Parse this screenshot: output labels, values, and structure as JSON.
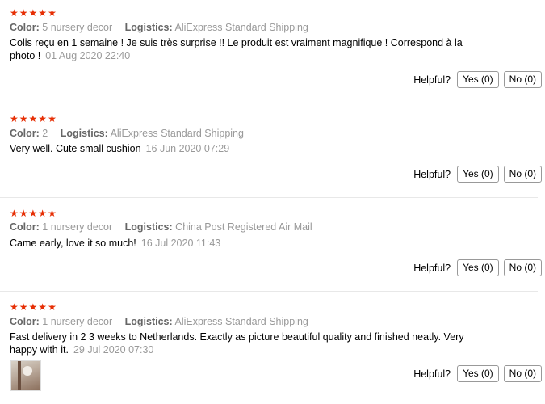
{
  "colors": {
    "star": "#e62e04",
    "muted": "#999999",
    "label": "#666666"
  },
  "labels": {
    "color": "Color:",
    "logistics": "Logistics:",
    "helpful": "Helpful?"
  },
  "reviews": [
    {
      "stars": 5,
      "color_value": "5 nursery decor",
      "logistics_value": "AliExpress Standard Shipping",
      "text": "Colis reçu en 1 semaine ! Je suis très surprise !! Le produit est vraiment magnifique ! Correspond à la photo !",
      "date": "01 Aug 2020 22:40",
      "yes_label": "Yes (0)",
      "no_label": "No (0)"
    },
    {
      "stars": 5,
      "color_value": "2",
      "logistics_value": "AliExpress Standard Shipping",
      "text": "Very well. Cute small cushion",
      "date": "16 Jun 2020 07:29",
      "yes_label": "Yes (0)",
      "no_label": "No (0)"
    },
    {
      "stars": 5,
      "color_value": "1 nursery decor",
      "logistics_value": "China Post Registered Air Mail",
      "text": "Came early, love it so much!",
      "date": "16 Jul 2020 11:43",
      "yes_label": "Yes (0)",
      "no_label": "No (0)"
    },
    {
      "stars": 5,
      "color_value": "1 nursery decor",
      "logistics_value": "AliExpress Standard Shipping",
      "text": "Fast delivery in 2 3 weeks to Netherlands. Exactly as picture beautiful quality and finished neatly. Very happy with it.",
      "date": "29 Jul 2020 07:30",
      "yes_label": "Yes (0)",
      "no_label": "No (0)"
    }
  ]
}
